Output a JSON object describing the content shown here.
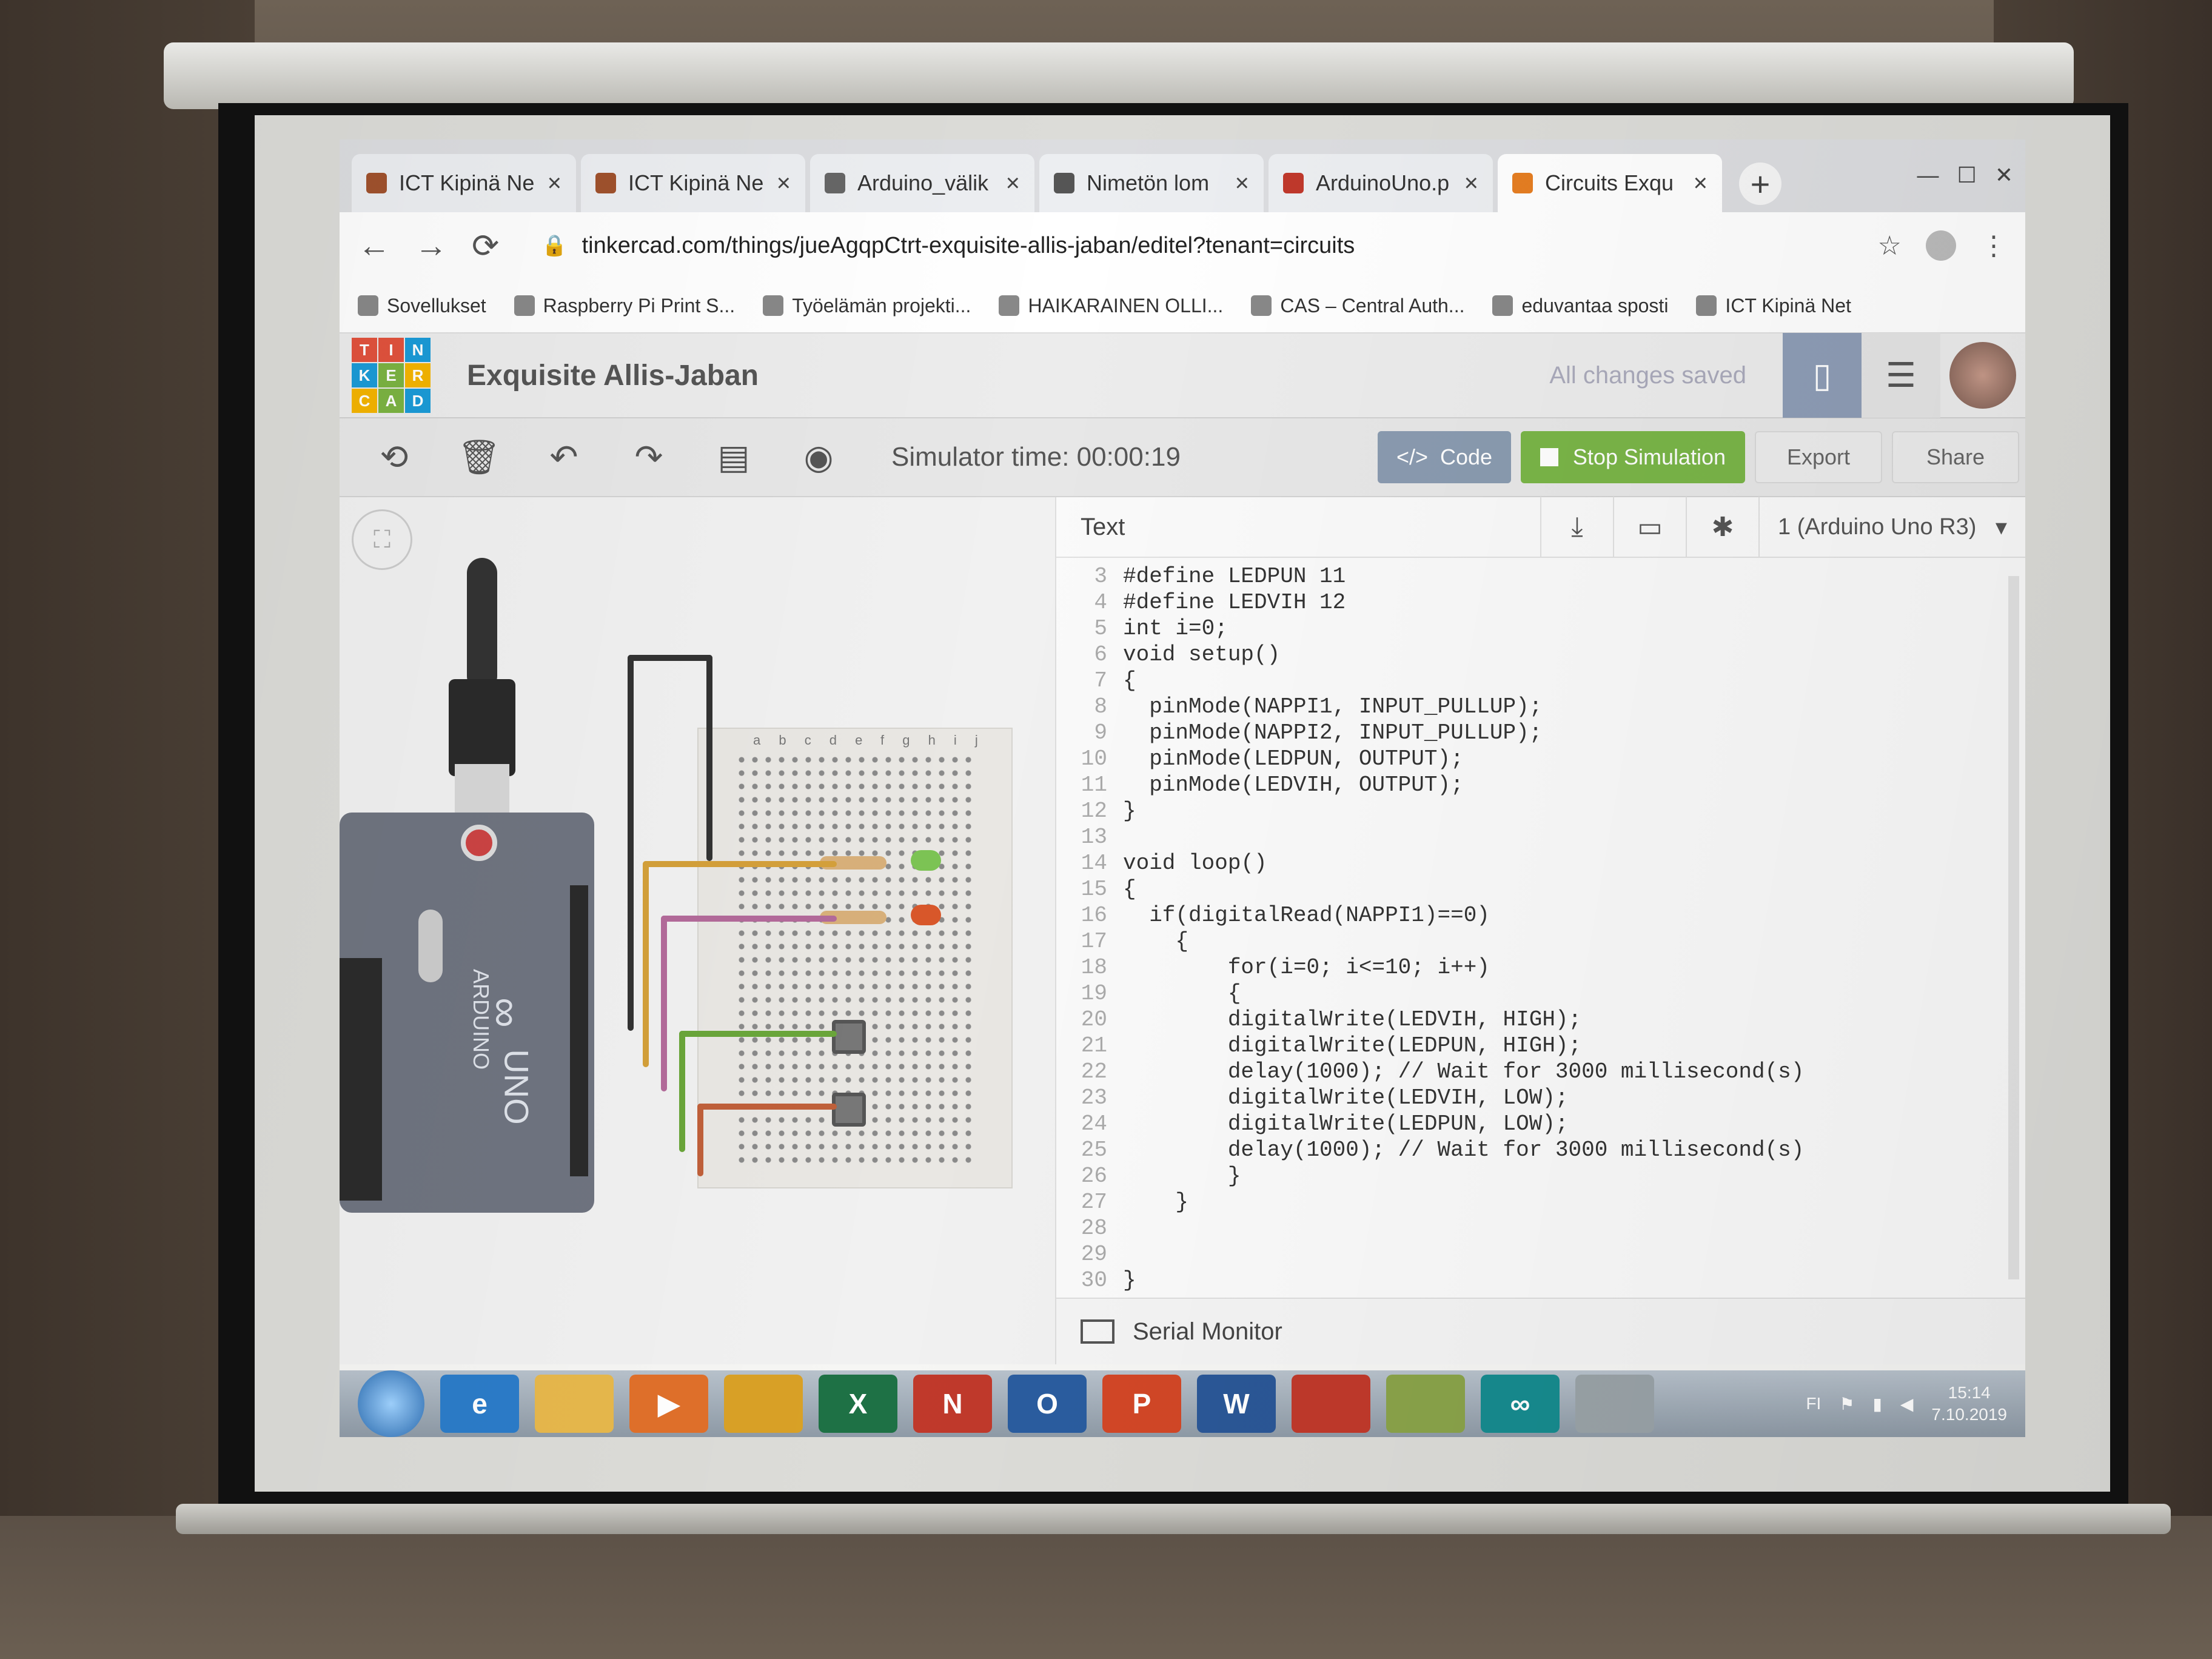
{
  "tabs": [
    {
      "label": "ICT Kipinä Ne",
      "color": "#a0522d"
    },
    {
      "label": "ICT Kipinä Ne",
      "color": "#a0522d"
    },
    {
      "label": "Arduino_välik",
      "color": "#666666"
    },
    {
      "label": "Nimetön lom",
      "color": "#555555"
    },
    {
      "label": "ArduinoUno.p",
      "color": "#c0392b"
    },
    {
      "label": "Circuits Exqu",
      "color": "#e67e22"
    }
  ],
  "url": "tinkercad.com/things/jueAgqpCtrt-exquisite-allis-jaban/editel?tenant=circuits",
  "bookmarks": [
    "Sovellukset",
    "Raspberry Pi Print S...",
    "Työelämän projekti...",
    "HAIKARAINEN OLLI...",
    "CAS – Central Auth...",
    "eduvantaa sposti",
    "ICT Kipinä Net"
  ],
  "tinkercad": {
    "logo_letters": [
      "T",
      "I",
      "N",
      "K",
      "E",
      "R",
      "C",
      "A",
      "D"
    ],
    "logo_colors": [
      "#e1523d",
      "#e1523d",
      "#1b9bd7",
      "#1b9bd7",
      "#7cb342",
      "#f4b400",
      "#f4b400",
      "#7cb342",
      "#1b9bd7"
    ],
    "project_title": "Exquisite Allis-Jaban",
    "save_status": "All changes saved"
  },
  "toolbar": {
    "simulator_time": "Simulator time: 00:00:19",
    "code_label": "Code",
    "stop_label": "Stop Simulation",
    "export_label": "Export",
    "share_label": "Share"
  },
  "codepanel": {
    "mode": "Text",
    "device": "1 (Arduino Uno R3)",
    "lines": [
      {
        "n": "3",
        "t": "#define LEDPUN 11"
      },
      {
        "n": "4",
        "t": "#define LEDVIH 12"
      },
      {
        "n": "5",
        "t": "int i=0;"
      },
      {
        "n": "6",
        "t": "void setup()"
      },
      {
        "n": "7",
        "t": "{"
      },
      {
        "n": "8",
        "t": "  pinMode(NAPPI1, INPUT_PULLUP);"
      },
      {
        "n": "9",
        "t": "  pinMode(NAPPI2, INPUT_PULLUP);"
      },
      {
        "n": "10",
        "t": "  pinMode(LEDPUN, OUTPUT);"
      },
      {
        "n": "11",
        "t": "  pinMode(LEDVIH, OUTPUT);"
      },
      {
        "n": "12",
        "t": "}"
      },
      {
        "n": "13",
        "t": ""
      },
      {
        "n": "14",
        "t": "void loop()"
      },
      {
        "n": "15",
        "t": "{"
      },
      {
        "n": "16",
        "t": "  if(digitalRead(NAPPI1)==0)"
      },
      {
        "n": "17",
        "t": "    {"
      },
      {
        "n": "18",
        "t": "        for(i=0; i<=10; i++)"
      },
      {
        "n": "19",
        "t": "        {"
      },
      {
        "n": "20",
        "t": "        digitalWrite(LEDVIH, HIGH);"
      },
      {
        "n": "21",
        "t": "        digitalWrite(LEDPUN, HIGH);"
      },
      {
        "n": "22",
        "t": "        delay(1000); // Wait for 3000 millisecond(s)"
      },
      {
        "n": "23",
        "t": "        digitalWrite(LEDVIH, LOW);"
      },
      {
        "n": "24",
        "t": "        digitalWrite(LEDPUN, LOW);"
      },
      {
        "n": "25",
        "t": "        delay(1000); // Wait for 3000 millisecond(s)"
      },
      {
        "n": "26",
        "t": "        }"
      },
      {
        "n": "27",
        "t": "    }"
      },
      {
        "n": "28",
        "t": ""
      },
      {
        "n": "29",
        "t": ""
      },
      {
        "n": "30",
        "t": "}"
      }
    ],
    "serial_monitor": "Serial Monitor"
  },
  "board": {
    "model": "UNO",
    "brand": "ARDUINO",
    "bb_cols_left": "a b c d e",
    "bb_cols_right": "f g h i j"
  },
  "taskbar": {
    "apps": [
      {
        "icon": "internet-explorer-icon",
        "label": "e",
        "color": "#2c7cc9"
      },
      {
        "icon": "file-explorer-icon",
        "label": "",
        "color": "#e7b84c"
      },
      {
        "icon": "media-player-icon",
        "label": "▶",
        "color": "#e0702a"
      },
      {
        "icon": "chrome-icon",
        "label": "",
        "color": "#d9a126"
      },
      {
        "icon": "excel-icon",
        "label": "X",
        "color": "#1e7145"
      },
      {
        "icon": "onenote-icon",
        "label": "N",
        "color": "#c0392b"
      },
      {
        "icon": "outlook-icon",
        "label": "O",
        "color": "#2a5d9f"
      },
      {
        "icon": "powerpoint-icon",
        "label": "P",
        "color": "#d24726"
      },
      {
        "icon": "word-icon",
        "label": "W",
        "color": "#2b5797"
      },
      {
        "icon": "vpn-icon",
        "label": "",
        "color": "#c0392b"
      },
      {
        "icon": "notepad-icon",
        "label": "",
        "color": "#8aa34a"
      },
      {
        "icon": "arduino-ide-icon",
        "label": "∞",
        "color": "#178b8f"
      },
      {
        "icon": "paper-icon",
        "label": "",
        "color": "#9aa3a8"
      }
    ],
    "lang": "FI",
    "time": "15:14",
    "date": "7.10.2019"
  }
}
